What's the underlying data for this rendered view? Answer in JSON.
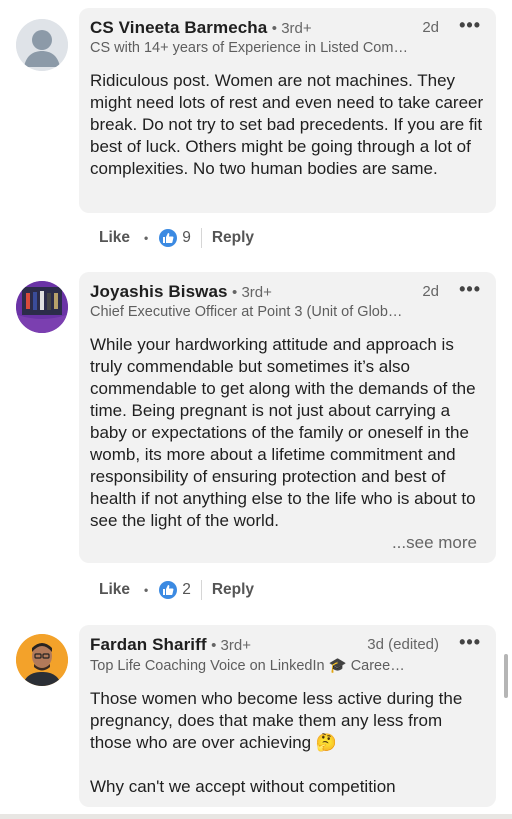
{
  "comments": [
    {
      "name": "CS Vineeta Barmecha",
      "degree": "• 3rd+",
      "time": "2d",
      "headline": "CS with 14+ years of Experience in Listed Com…",
      "body": "Ridiculous post. Women are not machines. They might need lots of rest and even need to take career break. Do not try to set bad precedents. If you are fit best of luck. Others might be going through a lot of complexities. No two human bodies are same.",
      "like_label": "Like",
      "reactions": "9",
      "reply_label": "Reply"
    },
    {
      "name": "Joyashis Biswas",
      "degree": "• 3rd+",
      "time": "2d",
      "headline": "Chief Executive Officer at Point 3 (Unit of Glob…",
      "body": "While your hardworking attitude and approach is truly commendable but sometimes it’s also commendable to get along with the demands of the time. Being pregnant is not just about carrying a baby or expectations of the family or oneself in the womb, its more about a lifetime commitment and responsibility of ensuring protection and best of health if not anything else to the life who is about to see the light of the world.",
      "see_more": "...see more",
      "like_label": "Like",
      "reactions": "2",
      "reply_label": "Reply"
    },
    {
      "name": "Fardan Shariff",
      "degree": "• 3rd+",
      "time": "3d (edited)",
      "headline": "Top Life Coaching Voice on LinkedIn 🎓 Caree…",
      "body_line1": "Those women who become less active during the pregnancy, does that make them any less from those who are over achieving 🤔",
      "body_line2": "Why can't we accept without competition"
    }
  ],
  "more_icon": "•••"
}
